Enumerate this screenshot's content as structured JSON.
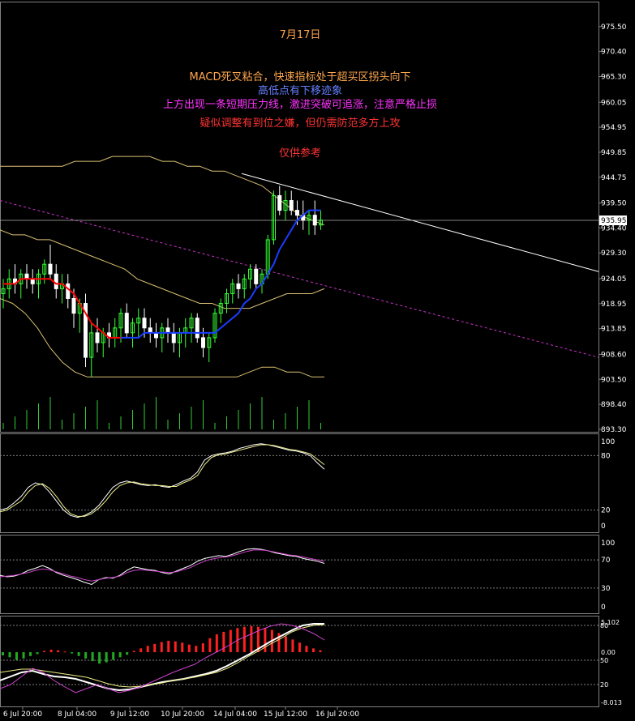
{
  "colors": {
    "background": "#000000",
    "grid": "#808080",
    "bull_candle": "#33ff33",
    "bear_candle": "#ffffff",
    "ma_red": "#ff0000",
    "ma_blue": "#1a3cff",
    "bollinger": "#d8c070",
    "channel": "#cc33cc",
    "trendline": "#ffffff",
    "volume": "#33cc33",
    "macd_hist_pos": "#ff2020",
    "macd_hist_neg": "#22aa22",
    "price_box_bg": "#ffffff",
    "text_orange": "#ffa64d",
    "text_blue": "#6680ff",
    "text_magenta": "#ff33ff",
    "text_red": "#ff3333"
  },
  "annotations": {
    "date": "7月17日",
    "line1": "MACD死叉粘合，快速指标处于超买区拐头向下",
    "line2": "高低点有下移迹象",
    "line3": "上方出现一条短期压力线，激进突破可追涨，注意严格止损",
    "line4": "疑似调整有到位之嫌，但仍需防范多方上攻",
    "line5": "仅供参考"
  },
  "chart_data": [
    {
      "type": "candlestick",
      "panel": "price",
      "ylim": [
        893.3,
        980.0
      ],
      "yticks": [
        "975.50",
        "970.40",
        "965.30",
        "960.05",
        "954.95",
        "949.85",
        "944.75",
        "939.50",
        "934.40",
        "929.30",
        "924.05",
        "918.95",
        "913.85",
        "908.60",
        "903.50",
        "898.40",
        "893.30"
      ],
      "current_price": "935.95",
      "ohlc": [
        [
          921,
          924,
          918,
          922
        ],
        [
          922,
          926,
          920,
          924
        ],
        [
          924,
          927,
          921,
          923
        ],
        [
          923,
          926,
          920,
          925
        ],
        [
          925,
          927,
          922,
          924
        ],
        [
          924,
          926,
          921,
          923
        ],
        [
          923,
          926,
          920,
          925
        ],
        [
          925,
          928,
          923,
          927
        ],
        [
          927,
          931,
          924,
          925
        ],
        [
          925,
          927,
          920,
          922
        ],
        [
          922,
          925,
          919,
          923
        ],
        [
          923,
          925,
          918,
          920
        ],
        [
          920,
          922,
          914,
          917
        ],
        [
          917,
          920,
          913,
          919
        ],
        [
          919,
          921,
          906,
          908
        ],
        [
          908,
          915,
          904,
          913
        ],
        [
          913,
          916,
          909,
          911
        ],
        [
          911,
          914,
          908,
          913
        ],
        [
          913,
          915,
          910,
          912
        ],
        [
          912,
          916,
          910,
          914
        ],
        [
          914,
          918,
          911,
          917
        ],
        [
          917,
          919,
          912,
          913
        ],
        [
          913,
          916,
          910,
          915
        ],
        [
          915,
          918,
          912,
          916
        ],
        [
          916,
          918,
          912,
          914
        ],
        [
          914,
          916,
          911,
          913
        ],
        [
          913,
          915,
          910,
          912
        ],
        [
          912,
          915,
          909,
          914
        ],
        [
          914,
          916,
          911,
          913
        ],
        [
          913,
          915,
          909,
          911
        ],
        [
          911,
          914,
          908,
          913
        ],
        [
          913,
          916,
          910,
          914
        ],
        [
          914,
          917,
          911,
          916
        ],
        [
          916,
          917,
          911,
          912
        ],
        [
          912,
          914,
          908,
          910
        ],
        [
          910,
          913,
          907,
          912
        ],
        [
          912,
          918,
          911,
          917
        ],
        [
          917,
          920,
          915,
          919
        ],
        [
          919,
          922,
          917,
          921
        ],
        [
          921,
          924,
          919,
          923
        ],
        [
          923,
          925,
          920,
          922
        ],
        [
          922,
          925,
          920,
          924
        ],
        [
          924,
          927,
          922,
          926
        ],
        [
          926,
          927,
          922,
          923
        ],
        [
          923,
          926,
          921,
          925
        ],
        [
          925,
          933,
          924,
          932
        ],
        [
          932,
          942,
          931,
          941
        ],
        [
          941,
          943,
          937,
          938
        ],
        [
          938,
          942,
          936,
          940
        ],
        [
          940,
          942,
          937,
          938
        ],
        [
          938,
          940,
          935,
          937
        ],
        [
          937,
          940,
          934,
          936
        ],
        [
          936,
          938,
          933,
          937
        ],
        [
          937,
          940,
          933,
          935
        ],
        [
          935,
          938,
          934,
          936
        ]
      ],
      "ma_red": [
        923,
        923,
        923,
        924,
        924,
        924,
        924,
        924,
        924,
        923,
        923,
        922,
        921,
        919,
        917,
        915,
        914,
        913,
        912,
        912,
        912,
        912,
        912,
        912,
        913,
        913,
        913,
        913,
        913,
        913,
        913,
        913,
        913,
        913,
        913,
        913,
        913,
        914,
        915,
        916,
        917,
        919,
        920,
        922,
        923,
        925,
        927,
        930,
        932,
        934,
        936,
        937,
        938,
        938,
        938
      ],
      "ma_red_until": 20,
      "bollinger_upper": [
        947,
        947,
        947,
        947,
        947,
        947,
        948,
        948,
        948,
        949,
        949,
        949,
        949,
        948,
        948,
        947,
        947,
        946,
        946,
        945,
        944,
        943,
        941,
        939,
        937,
        936,
        935
      ],
      "bollinger_mid": [
        934,
        933,
        933,
        932,
        932,
        931,
        930,
        929,
        928,
        927,
        926,
        924,
        923,
        922,
        921,
        920,
        919,
        919,
        918,
        918,
        918,
        919,
        920,
        921,
        921,
        921,
        922
      ],
      "bollinger_lower": [
        920,
        919,
        917,
        914,
        910,
        907,
        905,
        904,
        904,
        904,
        904,
        904,
        904,
        904,
        904,
        904,
        904,
        904,
        904,
        904,
        905,
        906,
        906,
        905,
        905,
        904,
        904
      ]
    },
    {
      "type": "line",
      "panel": "stochastic",
      "ylim": [
        0,
        100
      ],
      "levels": [
        20,
        80
      ],
      "yticks": [
        "100",
        "80",
        "20",
        "0"
      ],
      "series": [
        {
          "values": [
            20,
            22,
            28,
            35,
            45,
            50,
            48,
            40,
            30,
            20,
            14,
            12,
            14,
            18,
            25,
            35,
            45,
            50,
            52,
            50,
            48,
            47,
            48,
            46,
            45,
            48,
            52,
            55,
            62,
            75,
            80,
            82,
            83,
            85,
            88,
            90,
            92,
            93,
            92,
            90,
            88,
            86,
            85,
            83,
            80,
            72,
            65
          ]
        },
        {
          "values": [
            18,
            20,
            25,
            30,
            40,
            47,
            49,
            44,
            35,
            24,
            16,
            13,
            13,
            16,
            22,
            30,
            40,
            47,
            50,
            51,
            49,
            48,
            47,
            47,
            46,
            46,
            50,
            53,
            58,
            70,
            78,
            81,
            82,
            84,
            86,
            88,
            90,
            92,
            92,
            91,
            89,
            87,
            86,
            84,
            82,
            76,
            70
          ]
        }
      ]
    },
    {
      "type": "line",
      "panel": "rsi",
      "ylim": [
        0,
        100
      ],
      "levels": [
        30,
        70
      ],
      "yticks": [
        "100",
        "70",
        "30",
        "0"
      ],
      "series": [
        {
          "values": [
            48,
            46,
            47,
            50,
            55,
            58,
            62,
            58,
            52,
            48,
            45,
            42,
            38,
            35,
            42,
            45,
            44,
            48,
            55,
            60,
            58,
            56,
            55,
            52,
            50,
            54,
            58,
            62,
            68,
            72,
            74,
            76,
            75,
            78,
            82,
            85,
            86,
            85,
            83,
            80,
            78,
            76,
            75,
            72,
            70,
            68,
            65
          ]
        },
        {
          "values": [
            46,
            47,
            48,
            50,
            52,
            55,
            57,
            56,
            53,
            50,
            47,
            45,
            42,
            40,
            42,
            44,
            45,
            47,
            52,
            55,
            56,
            55,
            54,
            53,
            52,
            53,
            56,
            59,
            64,
            68,
            71,
            73,
            74,
            76,
            79,
            82,
            84,
            84,
            83,
            81,
            79,
            77,
            76,
            74,
            72,
            70,
            68
          ]
        }
      ]
    },
    {
      "type": "bar",
      "panel": "macd",
      "ylim": [
        -8.013,
        5.102
      ],
      "yticks": [
        "5.102",
        "0.00",
        "-8.013"
      ],
      "right_labels": [
        "80",
        "50",
        "20"
      ],
      "histogram": [
        -0.5,
        -0.8,
        -1.2,
        -1.0,
        -0.6,
        -0.3,
        0.2,
        0.4,
        0.3,
        0.1,
        -0.2,
        -0.6,
        -1.0,
        -1.4,
        -1.8,
        -1.6,
        -1.2,
        -0.8,
        -0.4,
        0.2,
        0.6,
        1.0,
        1.3,
        1.6,
        1.8,
        1.7,
        1.5,
        1.2,
        1.0,
        1.4,
        2.2,
        2.8,
        3.2,
        3.5,
        3.8,
        4.0,
        4.1,
        4.0,
        3.8,
        3.5,
        3.0,
        2.5,
        2.0,
        1.5,
        1.0,
        0.6,
        0.3
      ]
    }
  ],
  "x_labels": [
    "6 Jul 20:00",
    "8 Jul 04:00",
    "9 Jul 12:00",
    "10 Jul 20:00",
    "14 Jul 04:00",
    "15 Jul 12:00",
    "16 Jul 20:00"
  ]
}
